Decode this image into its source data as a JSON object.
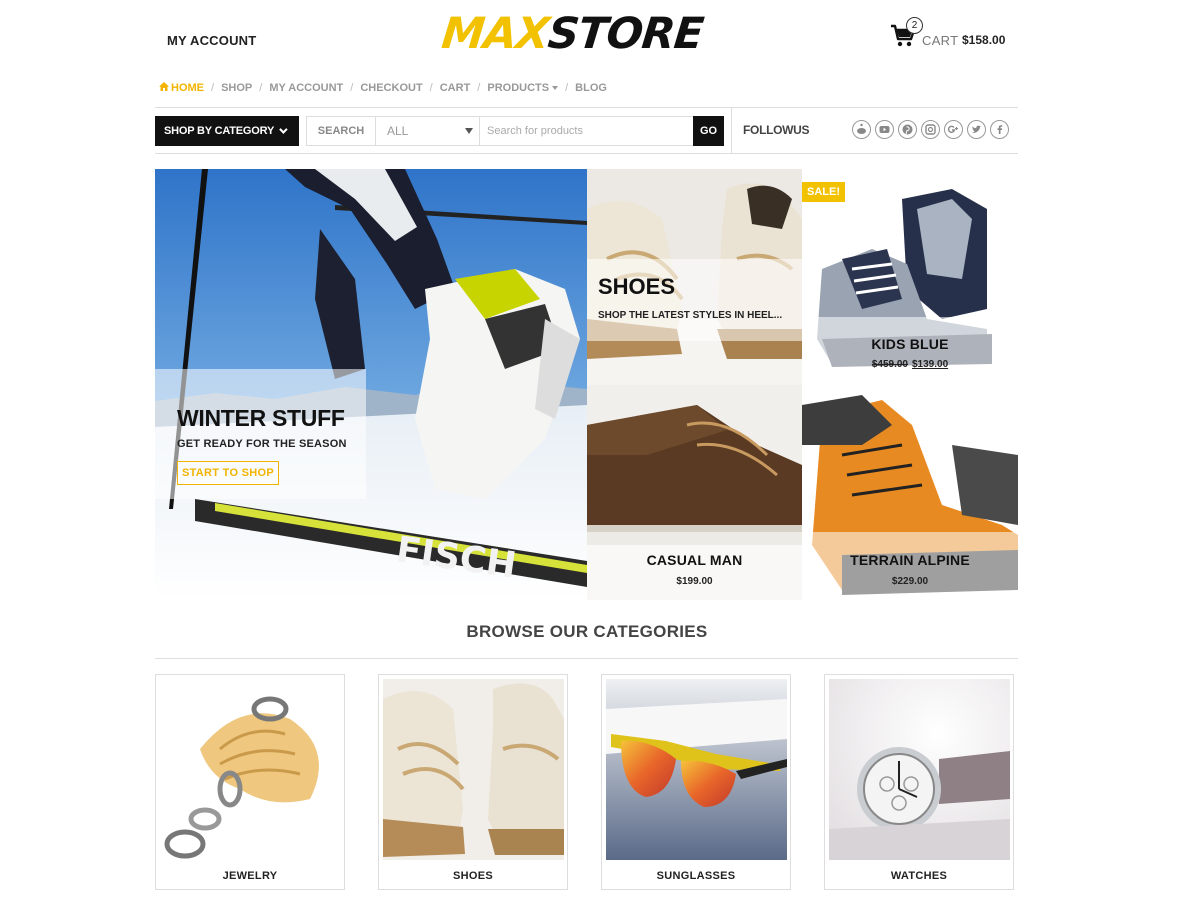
{
  "header": {
    "account_link": "MY ACCOUNT",
    "logo_part1": "MAX",
    "logo_part2": "STORE",
    "cart_count": "2",
    "cart_label": "CART",
    "cart_total": "$158.00"
  },
  "nav": {
    "home": "HOME",
    "shop": "SHOP",
    "my_account": "MY ACCOUNT",
    "checkout": "CHECKOUT",
    "cart": "CART",
    "products": "PRODUCTS",
    "blog": "BLOG",
    "separator": "/"
  },
  "search": {
    "category_button": "SHOP BY CATEGORY",
    "label": "SEARCH",
    "select_value": "ALL",
    "placeholder": "Search for products",
    "go": "GO"
  },
  "follow": {
    "label": "FOLLOWUS",
    "icons": [
      "reddit-icon",
      "youtube-icon",
      "pinterest-icon",
      "instagram-icon",
      "google-plus-icon",
      "twitter-icon",
      "facebook-icon"
    ]
  },
  "hero": {
    "title": "WINTER STUFF",
    "subtitle": "GET READY FOR THE SEASON",
    "button": "START TO SHOP"
  },
  "promo_shoes": {
    "title": "SHOES",
    "subtitle": "SHOP THE LATEST STYLES IN HEEL..."
  },
  "products": {
    "kids_blue": {
      "badge": "SALE!",
      "name": "KIDS BLUE",
      "old_price": "$459.00",
      "price": "$139.00"
    },
    "casual_man": {
      "name": "CASUAL MAN",
      "price": "$199.00"
    },
    "terrain_alpine": {
      "name": "TERRAIN ALPINE",
      "price": "$229.00"
    }
  },
  "categories": {
    "heading": "BROWSE OUR CATEGORIES",
    "items": [
      {
        "label": "JEWELRY"
      },
      {
        "label": "SHOES"
      },
      {
        "label": "SUNGLASSES"
      },
      {
        "label": "WATCHES"
      }
    ]
  },
  "colors": {
    "accent": "#f2c200",
    "dark": "#111111",
    "nav_text": "#999999"
  }
}
